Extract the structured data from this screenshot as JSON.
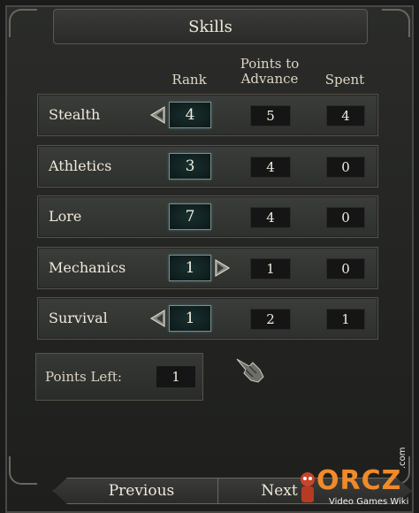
{
  "window": {
    "title": "Skills"
  },
  "headers": {
    "rank": "Rank",
    "points_to_advance": "Points to\nAdvance",
    "spent": "Spent"
  },
  "skills": [
    {
      "name": "Stealth",
      "rank": "4",
      "points_to_advance": "5",
      "spent": "4",
      "decrease": true,
      "increase": false
    },
    {
      "name": "Athletics",
      "rank": "3",
      "points_to_advance": "4",
      "spent": "0",
      "decrease": false,
      "increase": false
    },
    {
      "name": "Lore",
      "rank": "7",
      "points_to_advance": "4",
      "spent": "0",
      "decrease": false,
      "increase": false
    },
    {
      "name": "Mechanics",
      "rank": "1",
      "points_to_advance": "1",
      "spent": "0",
      "decrease": false,
      "increase": true
    },
    {
      "name": "Survival",
      "rank": "1",
      "points_to_advance": "2",
      "spent": "1",
      "decrease": true,
      "increase": false
    }
  ],
  "points_left": {
    "label": "Points Left:",
    "value": "1"
  },
  "nav": {
    "previous": "Previous",
    "next": "Next"
  },
  "watermark": {
    "logo": "ORCZ",
    "tld": ".com",
    "subtitle": "Video Games Wiki"
  },
  "icons": {
    "decrease": "arrow-left-icon",
    "increase": "arrow-right-icon",
    "cursor": "gauntlet-cursor-icon"
  },
  "colors": {
    "rank_glow": "#3a6e6c",
    "watermark_orange": "#f08a2a"
  }
}
